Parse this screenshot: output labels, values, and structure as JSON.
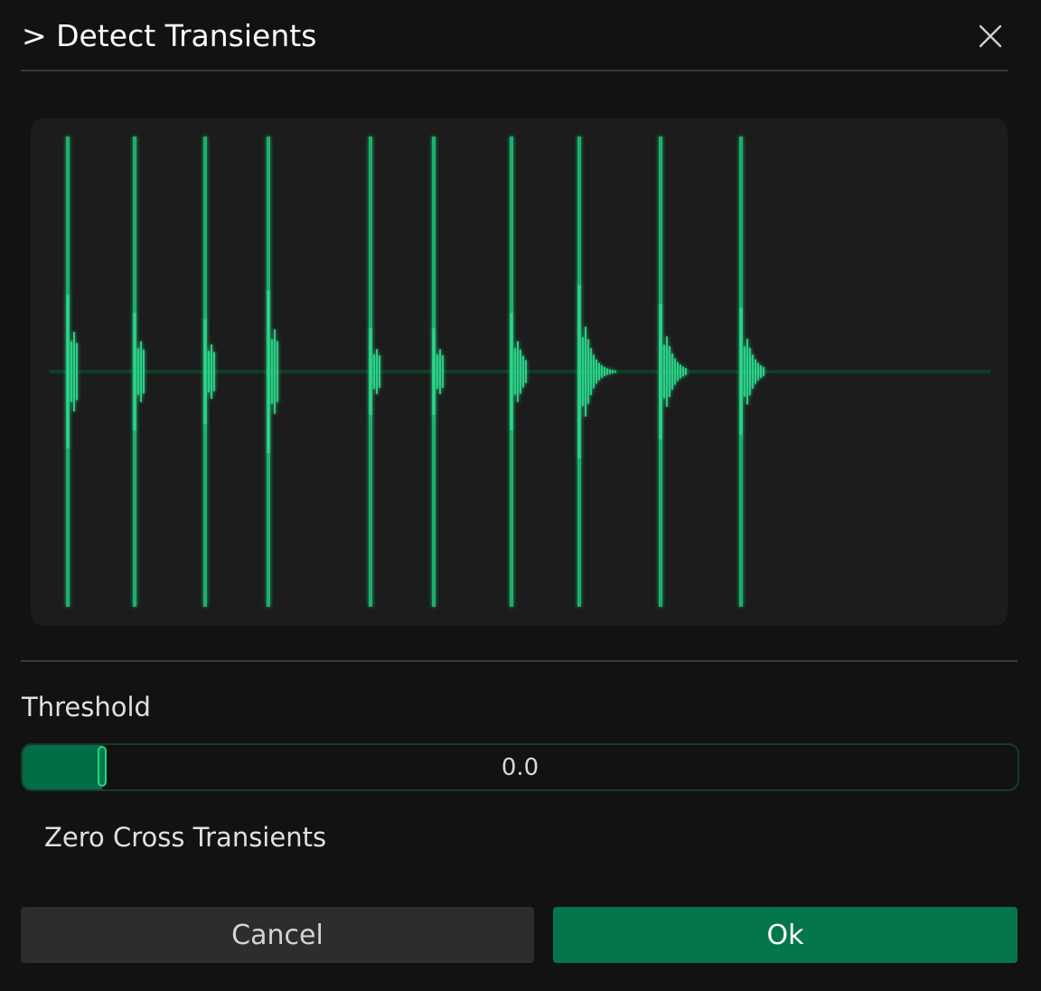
{
  "dialog": {
    "title": "> Detect Transients",
    "close_icon": "close-icon"
  },
  "waveform": {
    "accent_color": "#2bd68a",
    "line_color": "#1fb56f",
    "transient_count": 10
  },
  "threshold": {
    "label": "Threshold",
    "value_text": "0.0",
    "fill_fraction": 0.08
  },
  "zero_cross": {
    "label": "Zero Cross Transients"
  },
  "buttons": {
    "cancel_label": "Cancel",
    "ok_label": "Ok"
  },
  "colors": {
    "background": "#121212",
    "panel": "#1c1c1c",
    "accent": "#03774b",
    "accent_bright": "#27d486"
  }
}
